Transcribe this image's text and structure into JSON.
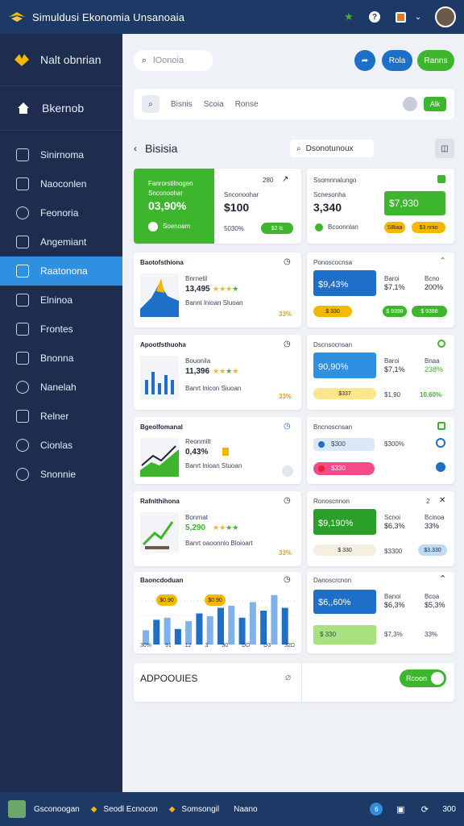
{
  "app": {
    "title": "Simuldusi Ekonomia Unsanoaia"
  },
  "sidebar": {
    "brand": "Nalt obnrian",
    "home": "Bkernob",
    "items": [
      {
        "label": "Sinirnoma"
      },
      {
        "label": "Naoconlen"
      },
      {
        "label": "Feonoria"
      },
      {
        "label": "Angemiant"
      },
      {
        "label": "Raatonona"
      },
      {
        "label": "Elninoa"
      },
      {
        "label": "Frontes"
      },
      {
        "label": "Bnonna"
      },
      {
        "label": "Nanelah"
      },
      {
        "label": "Relner"
      },
      {
        "label": "Cionlas"
      },
      {
        "label": "Snonnie"
      }
    ]
  },
  "main": {
    "search_placeholder": "lOonoia",
    "top_buttons": [
      "Rola",
      "Ranns"
    ],
    "toolbar": {
      "tabs": [
        "Bisnis",
        "Scoia",
        "Ronse"
      ],
      "action": "Alk"
    },
    "section": {
      "title": "Bisisia",
      "search_label": "Dsonotunoux"
    },
    "cards_left": [
      {
        "title": "Fanrorstilnogen",
        "subtitle": "Snconoohar",
        "value": "03,90%",
        "price": "$100",
        "note": "5030%",
        "badge": "$2 ls",
        "header_num": "280",
        "green_label": "Soenoam"
      },
      {
        "title": "Baotofsthiona",
        "l1": "Bnrnetil",
        "l2": "13,495",
        "l3": "Bannt lnioan Sluoan",
        "pct": "33%"
      },
      {
        "title": "Apootfsthuoha",
        "l1": "Bouonila",
        "l2": "11,396",
        "l3": "Banrt lnicon Siuoan",
        "pct": "33%"
      },
      {
        "title": "Bgeolfomanal",
        "l1": "Reonmilt",
        "l2": "0,43%",
        "l3": "Banrt lnioan Stuoan",
        "pct": ""
      },
      {
        "title": "Rafnlthihona",
        "l1": "Bonrnat",
        "l2": "5,290",
        "l3": "Banrt oaoonnlo Bloioart",
        "pct": "33%"
      },
      {
        "title": "Baoncdoduan",
        "chart_labels": [
          "30%",
          "91",
          "12",
          "3",
          "30",
          "DD",
          "D3",
          "32D"
        ],
        "badges": [
          "$0.90",
          "$0.90"
        ]
      }
    ],
    "cards_right": [
      {
        "title": "Ssomnnalungo",
        "subtitle": "Scnesonha",
        "value": "3,340",
        "green": "$7,930",
        "note": "Bcoonnlan",
        "pills": [
          "SBiaa",
          "$3 nnio"
        ]
      },
      {
        "title": "Ponoscocnsa",
        "blue": "$9,43%",
        "c2": "Baroi",
        "v2": "$7,1%",
        "c3": "Bcno",
        "v3": "200%",
        "pills": [
          "$ 330",
          "$ 9398",
          "$ 9388"
        ]
      },
      {
        "title": "Dscnsocnsan",
        "blue": "90,90%",
        "c2": "Baroi",
        "v2": "$7,1%",
        "c3": "Bnaa",
        "v3": "238%",
        "pills": [
          "$337",
          "$1,90",
          "10.60%"
        ]
      },
      {
        "title": "Bncnoscnsan",
        "pills": [
          "$300",
          "$300%",
          "$330"
        ]
      },
      {
        "title": "Ronoscnnon",
        "green": "$9,190%",
        "c2": "Scnoi",
        "v2": "$6,3%",
        "c3": "Bcinoa",
        "v3": "33%",
        "pills": [
          "$ 330",
          "$3300",
          "$3.330"
        ],
        "num": "2"
      },
      {
        "title": "Danoscrcnon",
        "blue": "$6,,60%",
        "c2": "Banoi",
        "v2": "$6,3%",
        "c3": "Bcoa",
        "v3": "$5,3%",
        "green": "$ 330",
        "pct": "33%",
        "pct2": "$7,3%"
      }
    ],
    "bottom": {
      "label": "ADPOOUIES",
      "button": "Rcoon"
    }
  },
  "footer": {
    "left": "Gsconoogan",
    "mid1": "Seodl Ecnocon",
    "mid2": "Somsongil",
    "mid3": "Naano",
    "right": "300",
    "badge": "6"
  },
  "chart_data": {
    "type": "bar",
    "categories": [
      "30%",
      "91",
      "12",
      "3",
      "30",
      "DD",
      "D3",
      "32D"
    ],
    "series": [
      {
        "values": [
          20,
          35,
          38,
          22,
          33,
          44,
          40,
          52,
          55,
          38,
          60,
          48,
          70,
          52
        ]
      }
    ]
  },
  "colors": {
    "green": "#3db52c",
    "blue": "#1e6fc8",
    "navy": "#1e2d4e",
    "accent": "#2f8fe0"
  }
}
